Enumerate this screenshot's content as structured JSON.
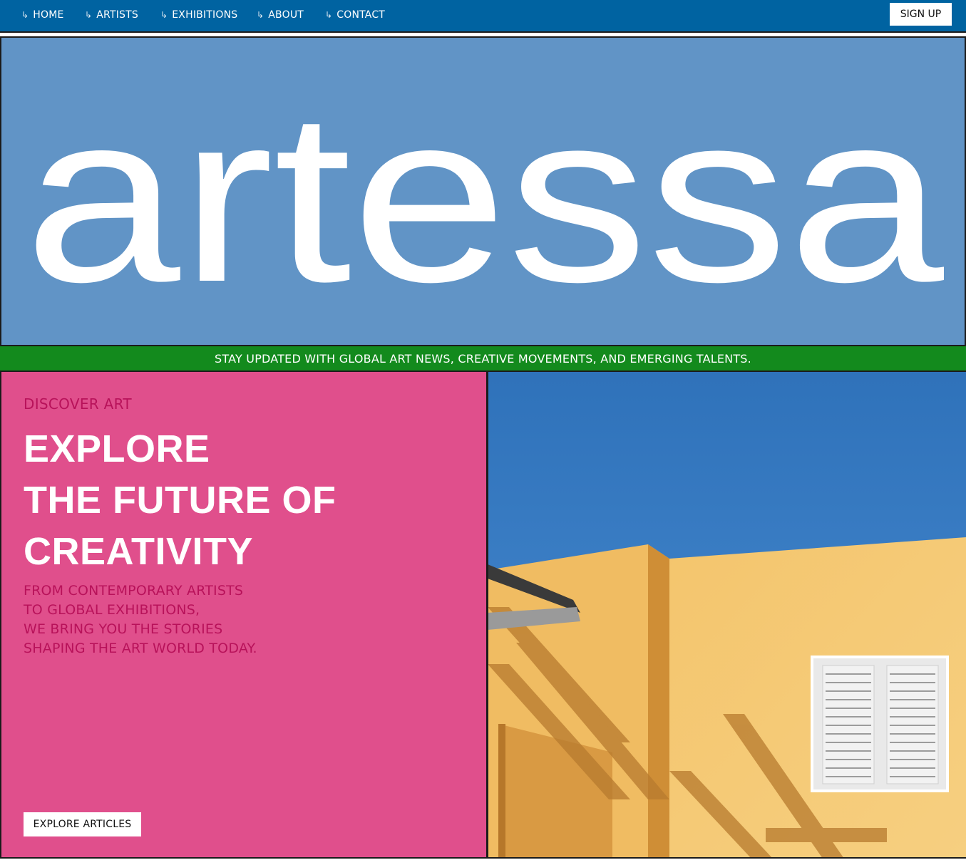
{
  "nav": {
    "arrow_glyph": "↳",
    "items": [
      {
        "label": "HOME"
      },
      {
        "label": "ARTISTS"
      },
      {
        "label": "EXHIBITIONS"
      },
      {
        "label": "ABOUT"
      },
      {
        "label": "CONTACT"
      }
    ],
    "signup_label": "SIGN UP"
  },
  "hero": {
    "wordmark": "artessa"
  },
  "ticker": {
    "text": "STAY UPDATED WITH GLOBAL ART NEWS, CREATIVE MOVEMENTS, AND EMERGING TALENTS."
  },
  "feature": {
    "eyebrow": "DISCOVER ART",
    "headline": [
      "EXPLORE",
      "THE FUTURE OF",
      "CREATIVITY"
    ],
    "copy": [
      "FROM CONTEMPORARY ARTISTS",
      "TO GLOBAL EXHIBITIONS,",
      "WE BRING YOU THE STORIES",
      "SHAPING THE ART WORLD TODAY."
    ],
    "cta_label": "EXPLORE ARTICLES"
  },
  "colors": {
    "nav_bg": "#0063a1",
    "hero_bg": "#6194c6",
    "ticker_bg": "#138a1d",
    "panel_bg": "#e04f8c",
    "panel_accent_text": "#b8125a"
  }
}
